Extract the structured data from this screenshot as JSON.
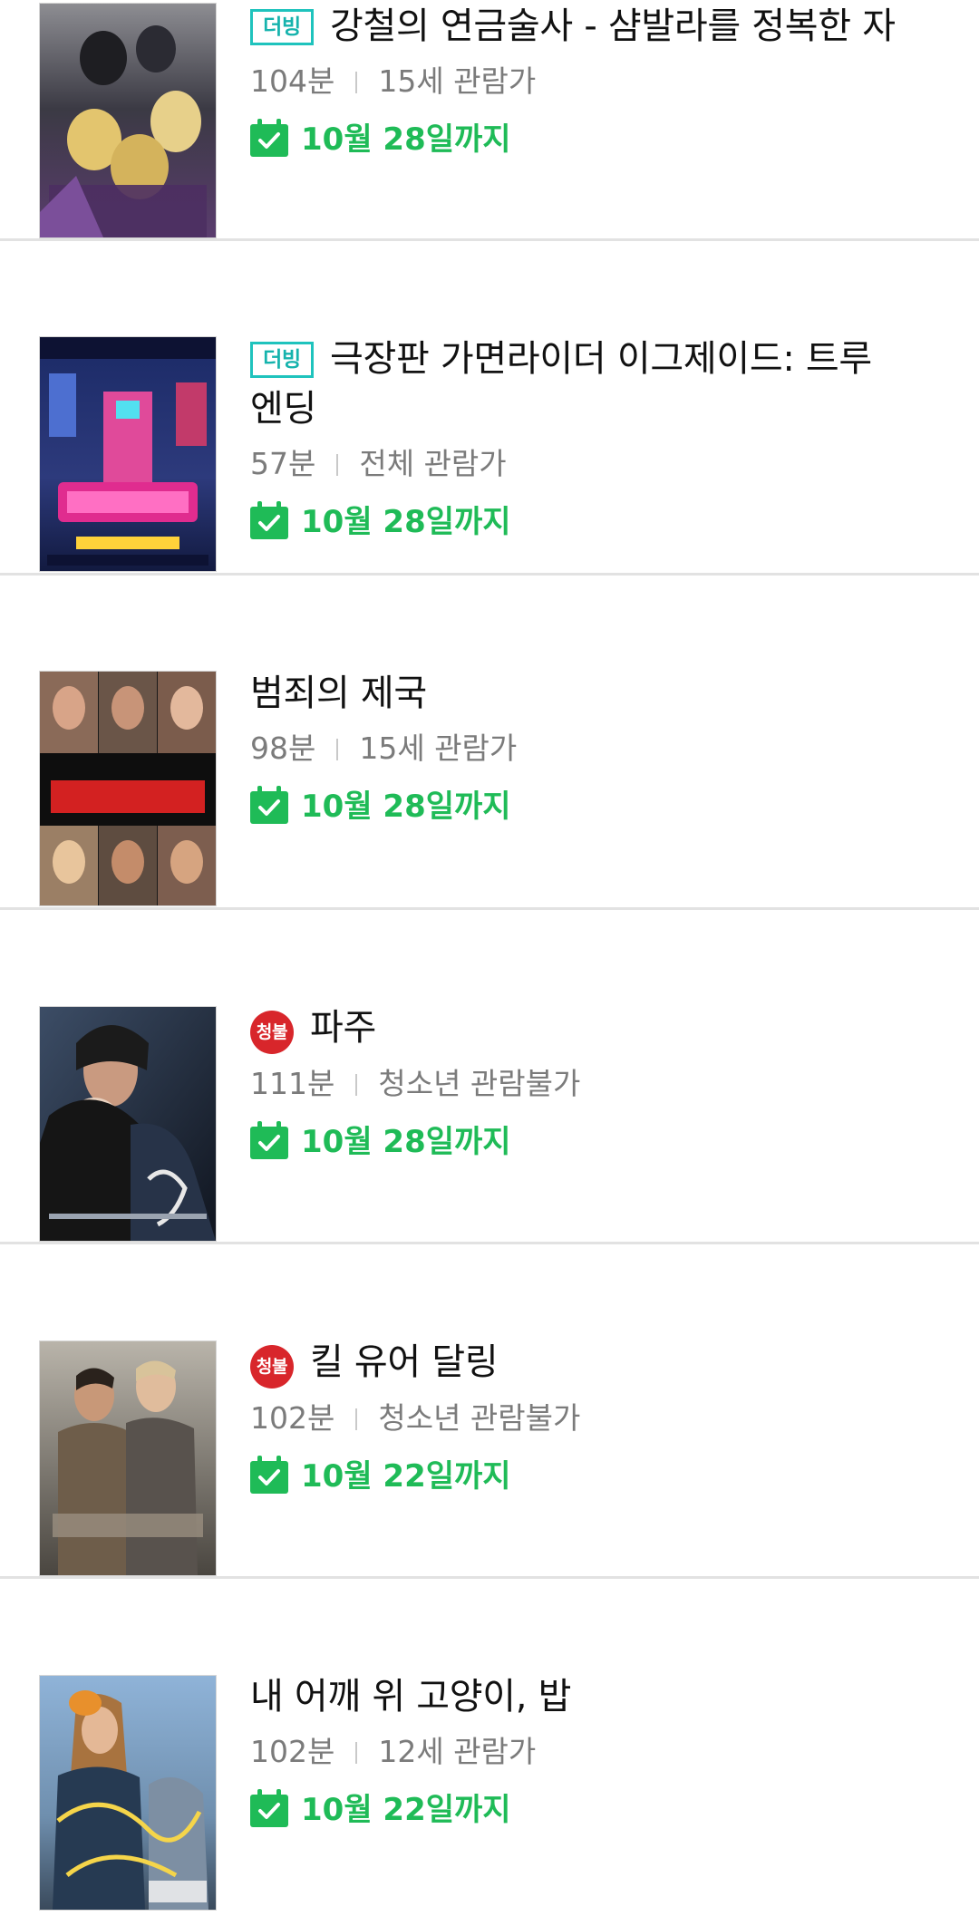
{
  "items": [
    {
      "badge": "더빙",
      "badge_type": "dub",
      "title": "강철의 연금술사 - 샴발라를 정복한 자",
      "runtime": "104분",
      "rating": "15세 관람가",
      "available_until": "10월 28일까지",
      "poster_icon": "movie-poster"
    },
    {
      "badge": "더빙",
      "badge_type": "dub",
      "title": "극장판 가면라이더 이그제이드: 트루 엔딩",
      "runtime": "57분",
      "rating": "전체 관람가",
      "available_until": "10월 28일까지",
      "poster_icon": "movie-poster"
    },
    {
      "badge": "",
      "badge_type": "none",
      "title": "범죄의 제국",
      "runtime": "98분",
      "rating": "15세 관람가",
      "available_until": "10월 28일까지",
      "poster_icon": "movie-poster"
    },
    {
      "badge": "청불",
      "badge_type": "adult",
      "title": "파주",
      "runtime": "111분",
      "rating": "청소년 관람불가",
      "available_until": "10월 28일까지",
      "poster_icon": "movie-poster"
    },
    {
      "badge": "청불",
      "badge_type": "adult",
      "title": "킬 유어 달링",
      "runtime": "102분",
      "rating": "청소년 관람불가",
      "available_until": "10월 22일까지",
      "poster_icon": "movie-poster"
    },
    {
      "badge": "",
      "badge_type": "none",
      "title": "내 어깨 위 고양이, 밥",
      "runtime": "102분",
      "rating": "12세 관람가",
      "available_until": "10월 22일까지",
      "poster_icon": "movie-poster"
    }
  ],
  "icons": {
    "calendar": "calendar-check-icon"
  },
  "colors": {
    "dub_badge": "#1fc3bd",
    "adult_badge": "#d8262b",
    "available_text": "#1fbb57",
    "meta_text": "#7b7b7b",
    "divider": "#e2e2e2"
  }
}
